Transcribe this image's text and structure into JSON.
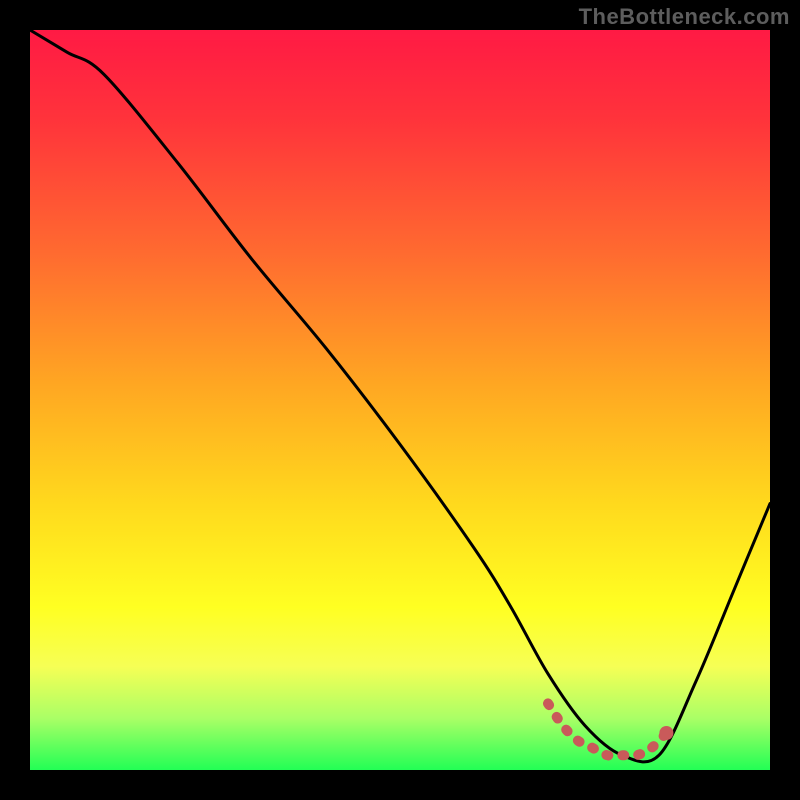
{
  "watermark": "TheBottleneck.com",
  "colors": {
    "curve": "#000000",
    "highlight_stroke": "#c95a5a",
    "highlight_dot": "#c95a5a",
    "background_black": "#000000"
  },
  "chart_data": {
    "type": "line",
    "title": "",
    "xlabel": "",
    "ylabel": "",
    "xlim": [
      0,
      100
    ],
    "ylim": [
      0,
      100
    ],
    "series": [
      {
        "name": "main-curve",
        "x": [
          0,
          5,
          10,
          20,
          30,
          40,
          50,
          60,
          65,
          70,
          75,
          80,
          85,
          90,
          95,
          100
        ],
        "values": [
          100,
          97,
          94,
          82,
          69,
          57,
          44,
          30,
          22,
          13,
          6,
          2,
          2,
          12,
          24,
          36
        ]
      },
      {
        "name": "highlight-band",
        "x": [
          70,
          72,
          74,
          76,
          78,
          80,
          82,
          84,
          86
        ],
        "values": [
          9,
          6,
          4,
          3,
          2,
          2,
          2,
          3,
          5
        ]
      }
    ],
    "annotations": []
  }
}
